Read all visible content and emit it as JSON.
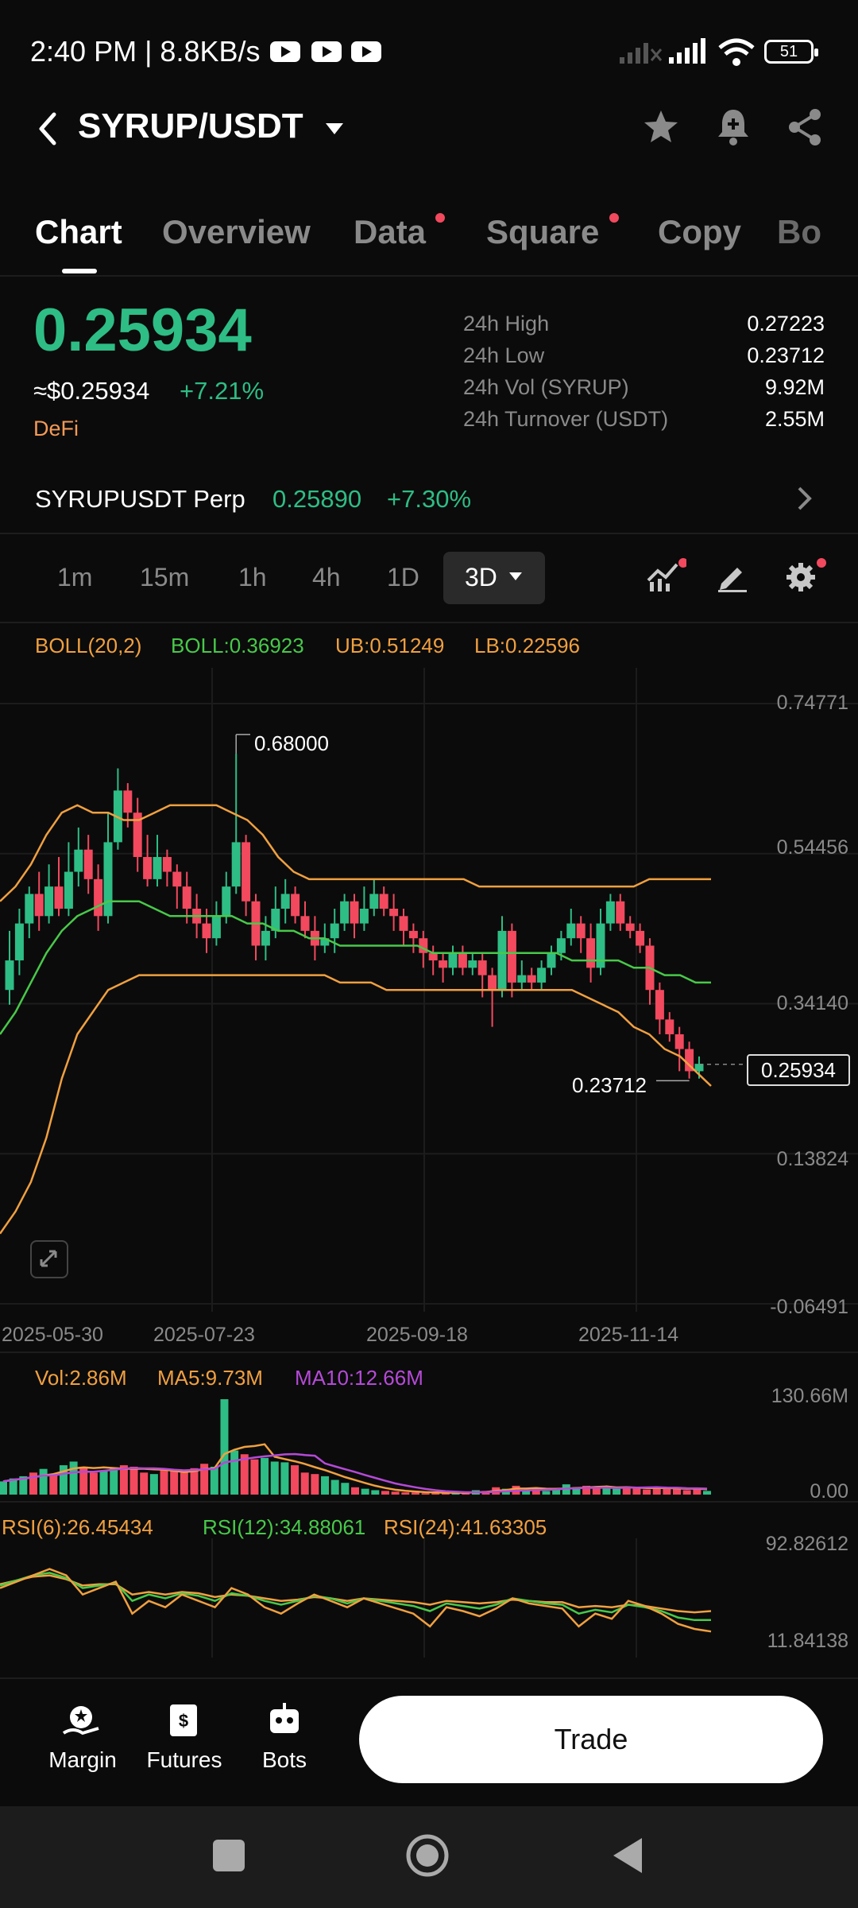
{
  "status_bar": {
    "time": "2:40 PM | 8.8KB/s",
    "battery": "51"
  },
  "header": {
    "pair": "SYRUP/USDT"
  },
  "tabs": [
    "Chart",
    "Overview",
    "Data",
    "Square",
    "Copy",
    "Bo"
  ],
  "ticker": {
    "price": "0.25934",
    "usd_price": "≈$0.25934",
    "change": "+7.21%",
    "category": "DeFi",
    "stats": [
      {
        "label": "24h High",
        "value": "0.27223"
      },
      {
        "label": "24h Low",
        "value": "0.23712"
      },
      {
        "label": "24h Vol (SYRUP)",
        "value": "9.92M"
      },
      {
        "label": "24h Turnover (USDT)",
        "value": "2.55M"
      }
    ]
  },
  "perp": {
    "name": "SYRUPUSDT Perp",
    "price": "0.25890",
    "change": "+7.30%"
  },
  "timeframes": [
    "1m",
    "15m",
    "1h",
    "4h",
    "1D",
    "3D"
  ],
  "indicators": {
    "boll_name": "BOLL(20,2)",
    "boll": "BOLL:0.36923",
    "ub": "UB:0.51249",
    "lb": "LB:0.22596",
    "vol": "Vol:2.86M",
    "ma5": "MA5:9.73M",
    "ma10": "MA10:12.66M",
    "rsi6": "RSI(6):26.45434",
    "rsi12": "RSI(12):34.88061",
    "rsi24": "RSI(24):41.63305"
  },
  "colors": {
    "up": "#2ebd85",
    "down": "#f2495e",
    "boll_band": "#f0a040",
    "boll_mid": "#48c94a",
    "ma10": "#b54ad8"
  },
  "chart_data": {
    "type": "candlestick",
    "price_axis_ticks": [
      "0.74771",
      "0.54456",
      "0.34140",
      "0.13824",
      "-0.06491"
    ],
    "x_tick_labels": [
      "2025-05-30",
      "2025-07-23",
      "2025-09-18",
      "2025-11-14"
    ],
    "high_marker": "0.68000",
    "low_marker": "0.23712",
    "last_price": "0.25934",
    "volume_axis_ticks": [
      "130.66M",
      "0.00"
    ],
    "rsi_axis_ticks": [
      "92.82612",
      "11.84138"
    ],
    "candles": [
      [
        0.36,
        0.4,
        0.44,
        0.34
      ],
      [
        0.4,
        0.45,
        0.47,
        0.38
      ],
      [
        0.45,
        0.49,
        0.5,
        0.43
      ],
      [
        0.49,
        0.46,
        0.52,
        0.44
      ],
      [
        0.46,
        0.5,
        0.53,
        0.45
      ],
      [
        0.5,
        0.47,
        0.54,
        0.46
      ],
      [
        0.47,
        0.52,
        0.56,
        0.46
      ],
      [
        0.52,
        0.55,
        0.58,
        0.5
      ],
      [
        0.55,
        0.51,
        0.57,
        0.49
      ],
      [
        0.51,
        0.46,
        0.53,
        0.44
      ],
      [
        0.46,
        0.56,
        0.6,
        0.45
      ],
      [
        0.56,
        0.63,
        0.66,
        0.55
      ],
      [
        0.63,
        0.6,
        0.64,
        0.58
      ],
      [
        0.6,
        0.54,
        0.62,
        0.52
      ],
      [
        0.54,
        0.51,
        0.57,
        0.5
      ],
      [
        0.51,
        0.54,
        0.57,
        0.5
      ],
      [
        0.54,
        0.52,
        0.55,
        0.5
      ],
      [
        0.52,
        0.5,
        0.53,
        0.47
      ],
      [
        0.5,
        0.47,
        0.52,
        0.45
      ],
      [
        0.47,
        0.45,
        0.49,
        0.43
      ],
      [
        0.45,
        0.43,
        0.47,
        0.41
      ],
      [
        0.43,
        0.46,
        0.48,
        0.42
      ],
      [
        0.46,
        0.5,
        0.52,
        0.45
      ],
      [
        0.5,
        0.56,
        0.68,
        0.49
      ],
      [
        0.56,
        0.48,
        0.57,
        0.46
      ],
      [
        0.48,
        0.42,
        0.49,
        0.4
      ],
      [
        0.42,
        0.44,
        0.46,
        0.4
      ],
      [
        0.44,
        0.47,
        0.5,
        0.43
      ],
      [
        0.47,
        0.49,
        0.51,
        0.45
      ],
      [
        0.49,
        0.46,
        0.5,
        0.45
      ],
      [
        0.46,
        0.44,
        0.48,
        0.43
      ],
      [
        0.44,
        0.42,
        0.46,
        0.4
      ],
      [
        0.42,
        0.43,
        0.45,
        0.41
      ],
      [
        0.43,
        0.45,
        0.47,
        0.41
      ],
      [
        0.45,
        0.48,
        0.49,
        0.44
      ],
      [
        0.48,
        0.45,
        0.49,
        0.43
      ],
      [
        0.45,
        0.47,
        0.5,
        0.44
      ],
      [
        0.47,
        0.49,
        0.51,
        0.46
      ],
      [
        0.49,
        0.47,
        0.5,
        0.46
      ],
      [
        0.47,
        0.46,
        0.49,
        0.44
      ],
      [
        0.46,
        0.44,
        0.47,
        0.42
      ],
      [
        0.44,
        0.43,
        0.45,
        0.41
      ],
      [
        0.43,
        0.41,
        0.44,
        0.39
      ],
      [
        0.41,
        0.4,
        0.42,
        0.38
      ],
      [
        0.4,
        0.39,
        0.41,
        0.37
      ],
      [
        0.39,
        0.41,
        0.42,
        0.38
      ],
      [
        0.41,
        0.39,
        0.42,
        0.38
      ],
      [
        0.39,
        0.4,
        0.41,
        0.38
      ],
      [
        0.4,
        0.38,
        0.41,
        0.35
      ],
      [
        0.38,
        0.36,
        0.39,
        0.31
      ],
      [
        0.36,
        0.44,
        0.46,
        0.35
      ],
      [
        0.44,
        0.37,
        0.45,
        0.35
      ],
      [
        0.37,
        0.38,
        0.4,
        0.36
      ],
      [
        0.38,
        0.37,
        0.39,
        0.36
      ],
      [
        0.37,
        0.39,
        0.4,
        0.36
      ],
      [
        0.39,
        0.41,
        0.42,
        0.38
      ],
      [
        0.41,
        0.43,
        0.44,
        0.4
      ],
      [
        0.43,
        0.45,
        0.47,
        0.42
      ],
      [
        0.45,
        0.43,
        0.46,
        0.41
      ],
      [
        0.43,
        0.39,
        0.45,
        0.37
      ],
      [
        0.39,
        0.45,
        0.47,
        0.38
      ],
      [
        0.45,
        0.48,
        0.49,
        0.44
      ],
      [
        0.48,
        0.45,
        0.49,
        0.44
      ],
      [
        0.45,
        0.44,
        0.46,
        0.43
      ],
      [
        0.44,
        0.42,
        0.45,
        0.41
      ],
      [
        0.42,
        0.36,
        0.43,
        0.34
      ],
      [
        0.36,
        0.32,
        0.37,
        0.3
      ],
      [
        0.32,
        0.3,
        0.33,
        0.29
      ],
      [
        0.3,
        0.28,
        0.31,
        0.25
      ],
      [
        0.28,
        0.25,
        0.29,
        0.24
      ],
      [
        0.25,
        0.26,
        0.27,
        0.24
      ]
    ],
    "boll_upper": [
      0.48,
      0.5,
      0.53,
      0.57,
      0.6,
      0.61,
      0.6,
      0.6,
      0.59,
      0.59,
      0.6,
      0.61,
      0.61,
      0.61,
      0.61,
      0.6,
      0.59,
      0.57,
      0.54,
      0.52,
      0.51,
      0.51,
      0.51,
      0.51,
      0.51,
      0.51,
      0.51,
      0.51,
      0.51,
      0.51,
      0.51,
      0.5,
      0.5,
      0.5,
      0.5,
      0.5,
      0.5,
      0.5,
      0.5,
      0.5,
      0.5,
      0.5,
      0.51,
      0.51,
      0.51,
      0.51,
      0.51
    ],
    "boll_mid": [
      0.3,
      0.33,
      0.37,
      0.41,
      0.44,
      0.46,
      0.47,
      0.48,
      0.48,
      0.48,
      0.47,
      0.46,
      0.46,
      0.46,
      0.46,
      0.46,
      0.45,
      0.45,
      0.44,
      0.44,
      0.43,
      0.43,
      0.42,
      0.42,
      0.42,
      0.42,
      0.42,
      0.42,
      0.41,
      0.41,
      0.41,
      0.41,
      0.41,
      0.41,
      0.41,
      0.41,
      0.41,
      0.4,
      0.4,
      0.4,
      0.4,
      0.39,
      0.39,
      0.38,
      0.38,
      0.37,
      0.37
    ],
    "boll_lower": [
      0.03,
      0.06,
      0.1,
      0.16,
      0.24,
      0.3,
      0.33,
      0.36,
      0.37,
      0.38,
      0.38,
      0.38,
      0.38,
      0.38,
      0.38,
      0.38,
      0.38,
      0.38,
      0.38,
      0.38,
      0.38,
      0.38,
      0.37,
      0.37,
      0.37,
      0.36,
      0.36,
      0.36,
      0.36,
      0.36,
      0.36,
      0.36,
      0.36,
      0.36,
      0.36,
      0.36,
      0.36,
      0.36,
      0.35,
      0.34,
      0.33,
      0.31,
      0.3,
      0.28,
      0.27,
      0.25,
      0.23
    ],
    "volume": [
      18,
      22,
      25,
      30,
      35,
      28,
      40,
      45,
      38,
      30,
      32,
      36,
      40,
      38,
      30,
      28,
      34,
      32,
      30,
      36,
      42,
      38,
      130,
      60,
      55,
      48,
      50,
      45,
      44,
      40,
      30,
      28,
      25,
      20,
      16,
      10,
      8,
      6,
      5,
      4,
      3,
      3,
      2,
      3,
      2,
      3,
      2,
      6,
      5,
      10,
      8,
      12,
      6,
      9,
      5,
      7,
      14,
      10,
      12,
      9,
      10,
      8,
      11,
      9,
      7,
      10,
      8,
      9,
      6,
      8,
      5
    ],
    "rsi6": [
      60,
      65,
      70,
      75,
      70,
      55,
      60,
      65,
      40,
      50,
      45,
      55,
      50,
      45,
      60,
      55,
      45,
      40,
      48,
      55,
      50,
      45,
      52,
      48,
      44,
      40,
      30,
      45,
      42,
      38,
      44,
      52,
      48,
      46,
      44,
      30,
      40,
      36,
      50,
      46,
      40,
      32,
      28,
      26
    ],
    "rsi12": [
      62,
      66,
      70,
      72,
      68,
      60,
      62,
      64,
      50,
      55,
      52,
      56,
      54,
      50,
      56,
      54,
      50,
      47,
      50,
      54,
      52,
      48,
      52,
      50,
      48,
      46,
      42,
      48,
      46,
      44,
      47,
      52,
      50,
      48,
      47,
      40,
      43,
      41,
      47,
      45,
      42,
      37,
      35,
      35
    ],
    "rsi24": [
      63,
      66,
      69,
      70,
      67,
      62,
      63,
      63,
      55,
      57,
      55,
      57,
      56,
      53,
      55,
      54,
      52,
      50,
      51,
      53,
      52,
      50,
      52,
      51,
      50,
      49,
      47,
      50,
      49,
      48,
      49,
      51,
      50,
      49,
      49,
      45,
      46,
      45,
      47,
      46,
      44,
      42,
      41,
      42
    ]
  },
  "bottom_nav": {
    "margin": "Margin",
    "futures": "Futures",
    "bots": "Bots",
    "trade": "Trade"
  }
}
